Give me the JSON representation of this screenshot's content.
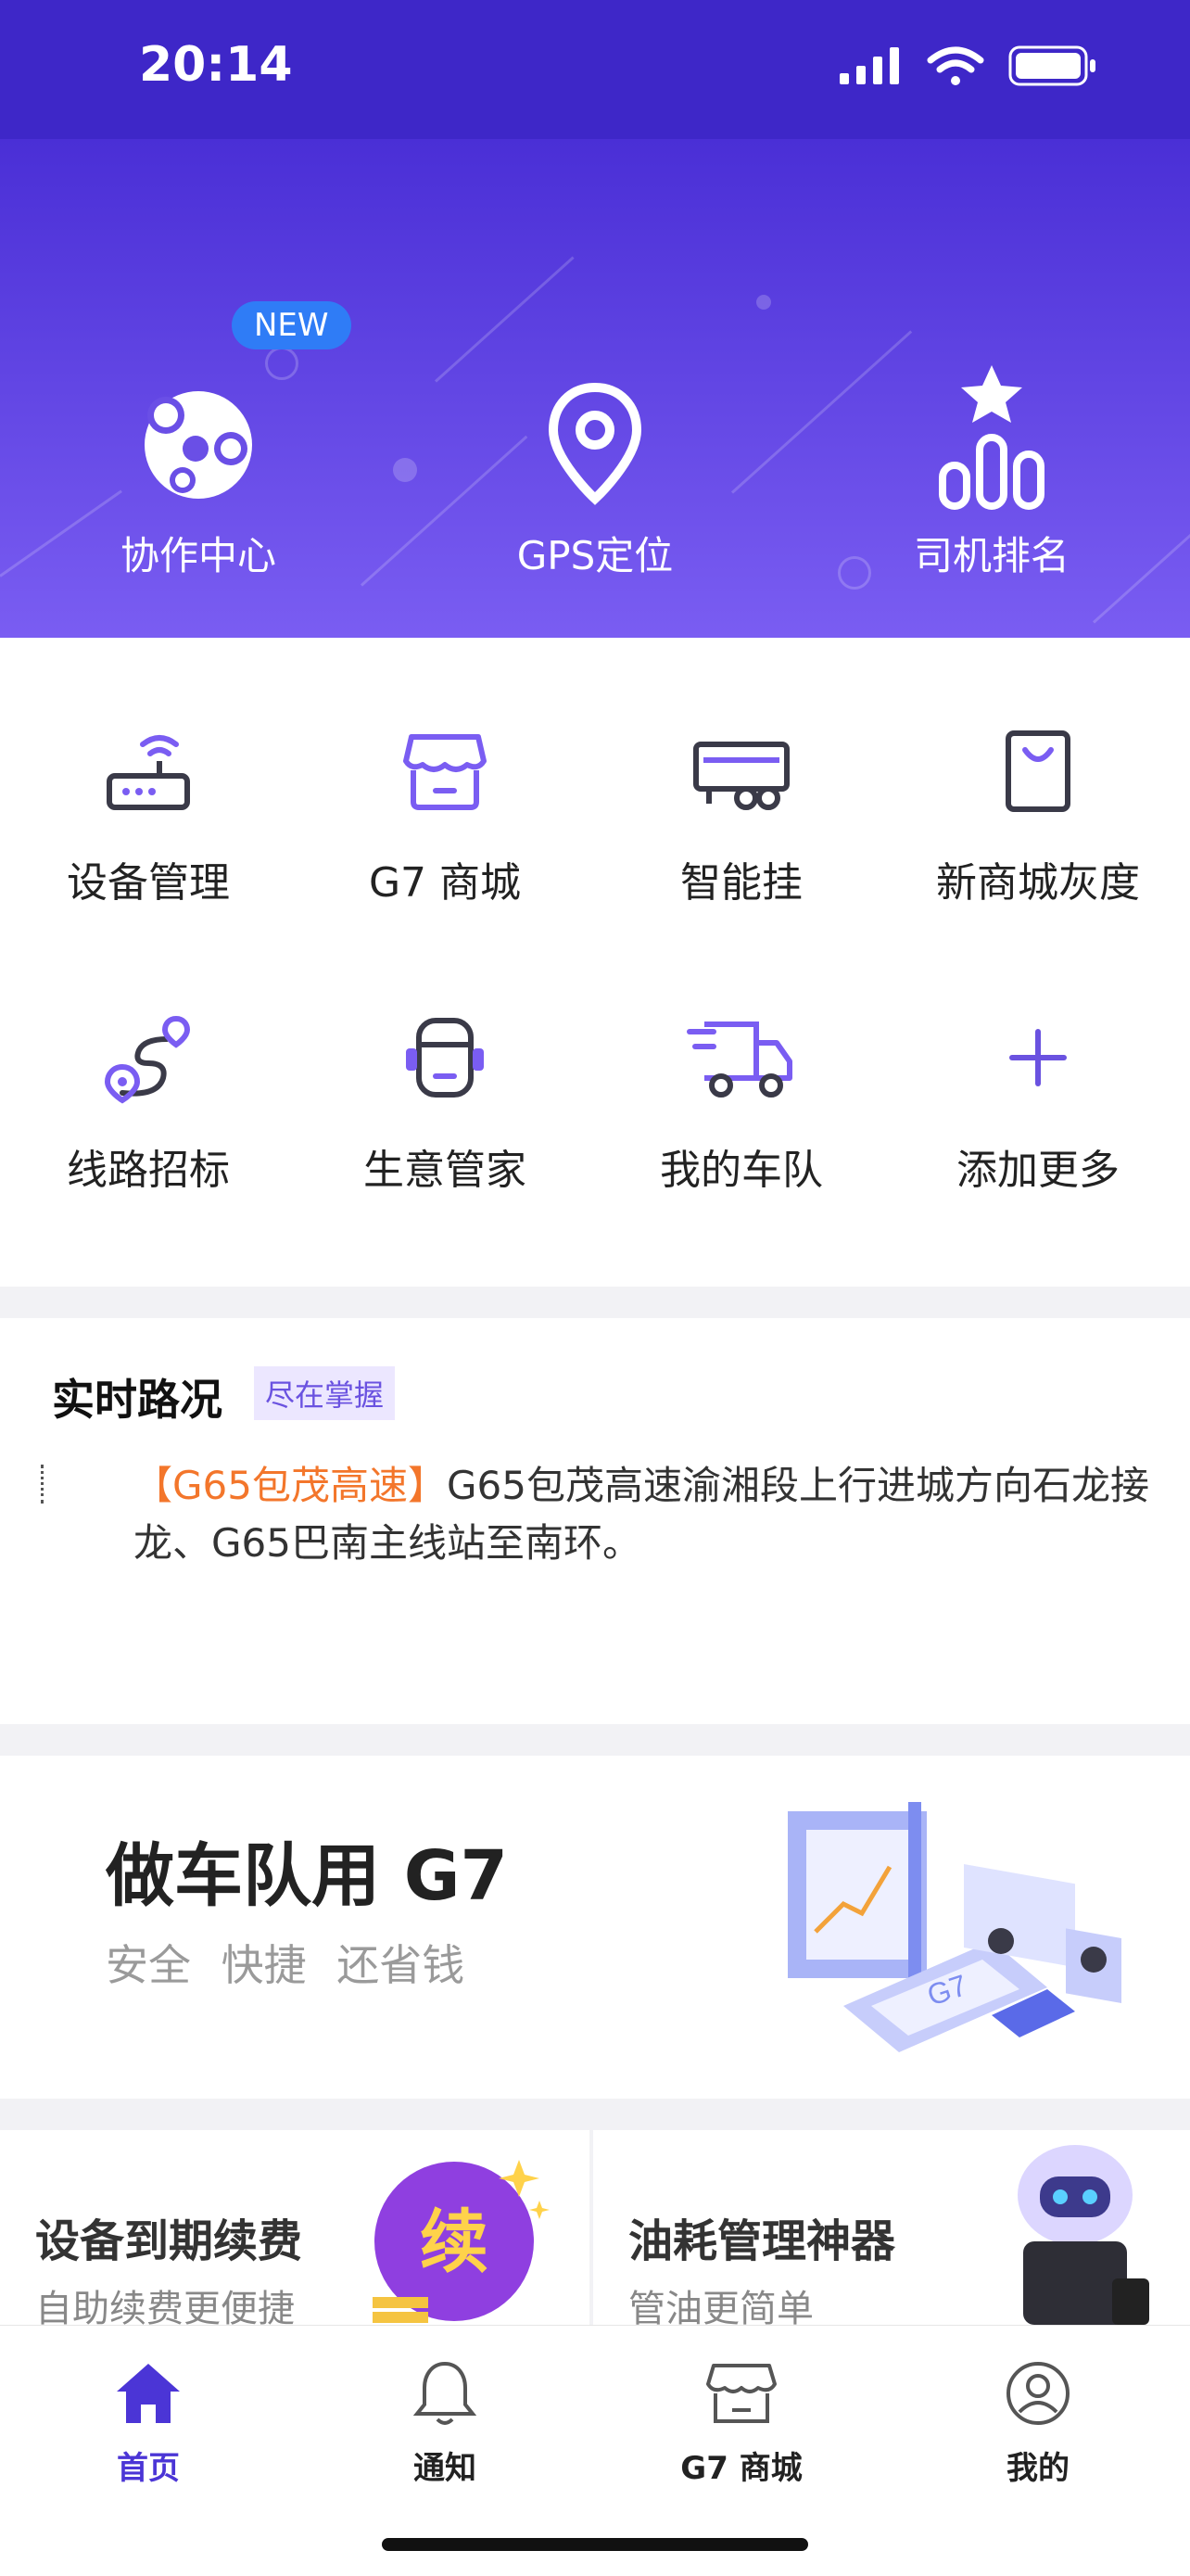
{
  "status_bar": {
    "time": "20:14"
  },
  "hero": {
    "items": [
      {
        "label": "协作中心",
        "badge": "NEW",
        "icon": "collab-icon"
      },
      {
        "label": "GPS定位",
        "icon": "location-pin-icon"
      },
      {
        "label": "司机排名",
        "icon": "ranking-icon"
      }
    ]
  },
  "grid": {
    "items": [
      {
        "label": "设备管理",
        "icon": "router-icon"
      },
      {
        "label": "G7 商城",
        "icon": "store-icon"
      },
      {
        "label": "智能挂",
        "icon": "trailer-icon"
      },
      {
        "label": "新商城灰度",
        "icon": "shopping-bag-icon"
      },
      {
        "label": "线路招标",
        "icon": "route-icon"
      },
      {
        "label": "生意管家",
        "icon": "assistant-icon"
      },
      {
        "label": "我的车队",
        "icon": "truck-icon"
      },
      {
        "label": "添加更多",
        "icon": "plus-icon"
      }
    ]
  },
  "traffic": {
    "title": "实时路况",
    "tag": "尽在掌握",
    "highlight": "【G65包茂高速】",
    "text": "G65包茂高速渝湘段上行进城方向石龙接龙、G65巴南主线站至南环。"
  },
  "banner": {
    "title": "做车队用 G7",
    "subtitle": "安全  快捷  还省钱",
    "illustration_text": "G7"
  },
  "cards": [
    {
      "title": "设备到期续费",
      "subtitle": "自助续费更便捷",
      "icon_text": "续"
    },
    {
      "title": "油耗管理神器",
      "subtitle": "管油更简单"
    }
  ],
  "tabbar": {
    "items": [
      {
        "label": "首页",
        "icon": "home-icon",
        "active": true
      },
      {
        "label": "通知",
        "icon": "bell-icon",
        "active": false
      },
      {
        "label": "G7 商城",
        "icon": "store-icon",
        "active": false
      },
      {
        "label": "我的",
        "icon": "profile-icon",
        "active": false
      }
    ]
  },
  "colors": {
    "primary": "#4b35d6",
    "hero_top": "#4a2fd6",
    "hero_bottom": "#7a5df2",
    "highlight": "#f3762b"
  }
}
